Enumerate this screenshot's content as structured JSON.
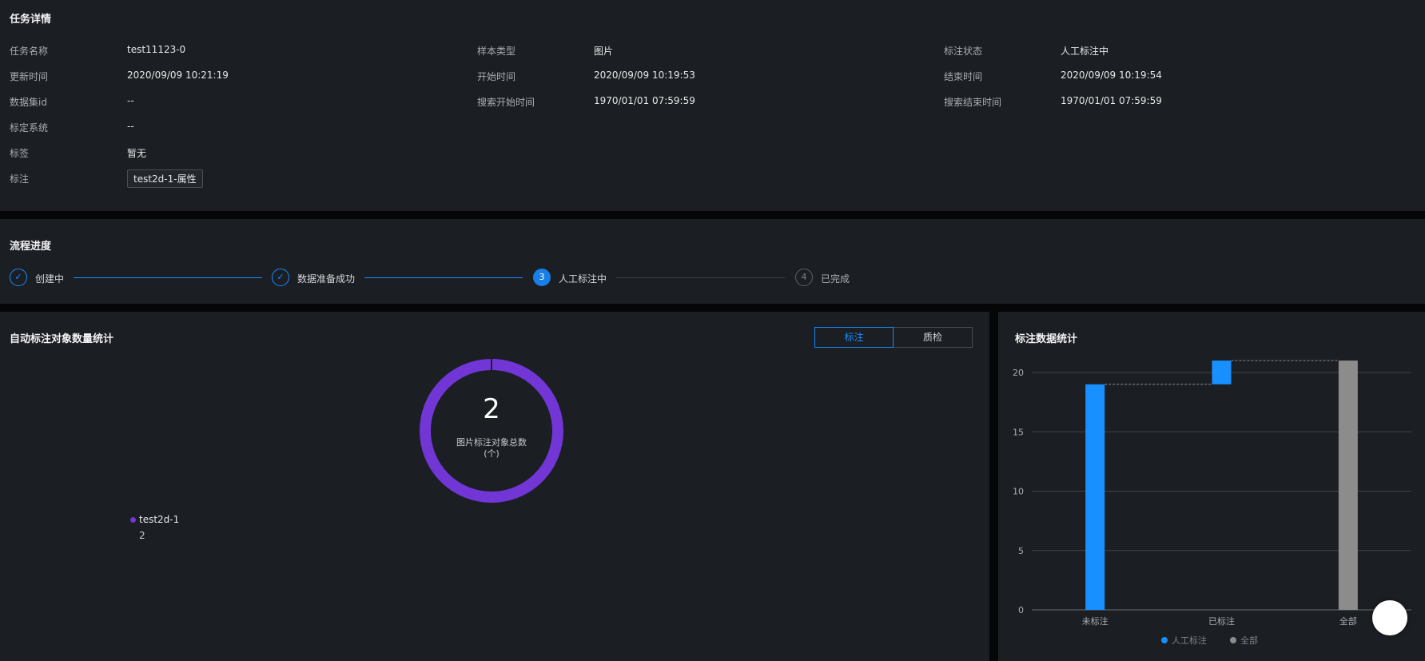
{
  "details": {
    "title": "任务详情",
    "fields": [
      {
        "label": "任务名称",
        "value": "test11123-0"
      },
      {
        "label": "样本类型",
        "value": "图片"
      },
      {
        "label": "标注状态",
        "value": "人工标注中"
      },
      {
        "label": "更新时间",
        "value": "2020/09/09 10:21:19"
      },
      {
        "label": "开始时间",
        "value": "2020/09/09 10:19:53"
      },
      {
        "label": "结束时间",
        "value": "2020/09/09 10:19:54"
      },
      {
        "label": "数据集id",
        "value": "--"
      },
      {
        "label": "搜索开始时间",
        "value": "1970/01/01 07:59:59"
      },
      {
        "label": "搜索结束时间",
        "value": "1970/01/01 07:59:59"
      },
      {
        "label": "标定系统",
        "value": "--"
      },
      {
        "label": "标签",
        "value": "暂无"
      },
      {
        "label": "标注",
        "value": "test2d-1-属性"
      }
    ]
  },
  "progress": {
    "title": "流程进度",
    "steps": [
      {
        "label": "创建中",
        "status": "done",
        "marker": "✓"
      },
      {
        "label": "数据准备成功",
        "status": "done",
        "marker": "✓"
      },
      {
        "label": "人工标注中",
        "status": "active",
        "marker": "3"
      },
      {
        "label": "已完成",
        "status": "pending",
        "marker": "4"
      }
    ]
  },
  "auto_stats": {
    "title": "自动标注对象数量统计",
    "tabs": [
      {
        "label": "标注",
        "active": true
      },
      {
        "label": "质检",
        "active": false
      }
    ],
    "donut": {
      "total": "2",
      "caption_line1": "图片标注对象总数",
      "caption_line2": "(个)",
      "color": "#7236d6"
    },
    "legend": [
      {
        "name": "test2d-1",
        "value": "2",
        "color": "#7236d6"
      }
    ]
  },
  "label_stats": {
    "title": "标注数据统计",
    "colors": {
      "manual": "#1890ff",
      "total": "#8c8c8c"
    }
  },
  "chart_data": {
    "type": "bar",
    "categories": [
      "未标注",
      "已标注",
      "全部"
    ],
    "series": [
      {
        "name": "人工标注",
        "values": [
          [
            0,
            19
          ],
          [
            19,
            21
          ],
          null
        ]
      },
      {
        "name": "全部",
        "values": [
          null,
          null,
          21
        ]
      }
    ],
    "ylim": [
      0,
      21
    ],
    "yticks": [
      0,
      5,
      10,
      15,
      20
    ],
    "grid": true,
    "legend": "bottom"
  },
  "fab": {
    "icon": "floating-action-icon"
  }
}
